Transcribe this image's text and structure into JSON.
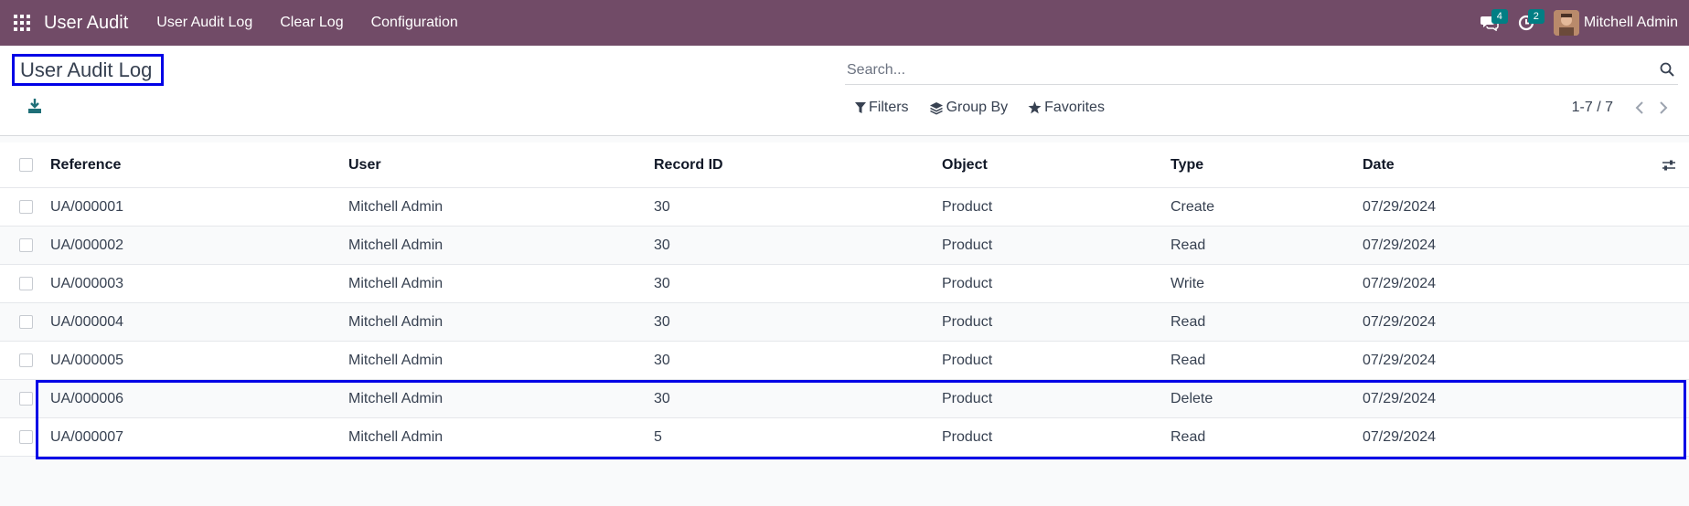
{
  "navbar": {
    "app_name": "User Audit",
    "menu": [
      "User Audit Log",
      "Clear Log",
      "Configuration"
    ],
    "messages_badge": "4",
    "activity_badge": "2",
    "user_name": "Mitchell Admin",
    "bg_color": "#714b67"
  },
  "page": {
    "title": "User Audit Log"
  },
  "search": {
    "placeholder": "Search..."
  },
  "filters": {
    "filters_label": "Filters",
    "group_by_label": "Group By",
    "favorites_label": "Favorites"
  },
  "pager": {
    "value": "1-7 / 7"
  },
  "table": {
    "columns": [
      "Reference",
      "User",
      "Record ID",
      "Object",
      "Type",
      "Date"
    ],
    "rows": [
      {
        "reference": "UA/000001",
        "user": "Mitchell Admin",
        "record_id": "30",
        "object": "Product",
        "type": "Create",
        "date": "07/29/2024"
      },
      {
        "reference": "UA/000002",
        "user": "Mitchell Admin",
        "record_id": "30",
        "object": "Product",
        "type": "Read",
        "date": "07/29/2024"
      },
      {
        "reference": "UA/000003",
        "user": "Mitchell Admin",
        "record_id": "30",
        "object": "Product",
        "type": "Write",
        "date": "07/29/2024"
      },
      {
        "reference": "UA/000004",
        "user": "Mitchell Admin",
        "record_id": "30",
        "object": "Product",
        "type": "Read",
        "date": "07/29/2024"
      },
      {
        "reference": "UA/000005",
        "user": "Mitchell Admin",
        "record_id": "30",
        "object": "Product",
        "type": "Read",
        "date": "07/29/2024"
      },
      {
        "reference": "UA/000006",
        "user": "Mitchell Admin",
        "record_id": "30",
        "object": "Product",
        "type": "Delete",
        "date": "07/29/2024"
      },
      {
        "reference": "UA/000007",
        "user": "Mitchell Admin",
        "record_id": "5",
        "object": "Product",
        "type": "Read",
        "date": "07/29/2024"
      }
    ]
  },
  "icons": {
    "apps": "apps-grid-icon",
    "messages": "chat-icon",
    "activity": "clock-icon",
    "download": "download-icon",
    "search": "search-icon",
    "filter": "funnel-icon",
    "group_by": "layers-icon",
    "favorites": "star-icon",
    "prev": "chevron-left-icon",
    "next": "chevron-right-icon",
    "optional_columns": "sliders-icon"
  },
  "colors": {
    "highlight": "#0000e6",
    "badge": "#017e84"
  }
}
